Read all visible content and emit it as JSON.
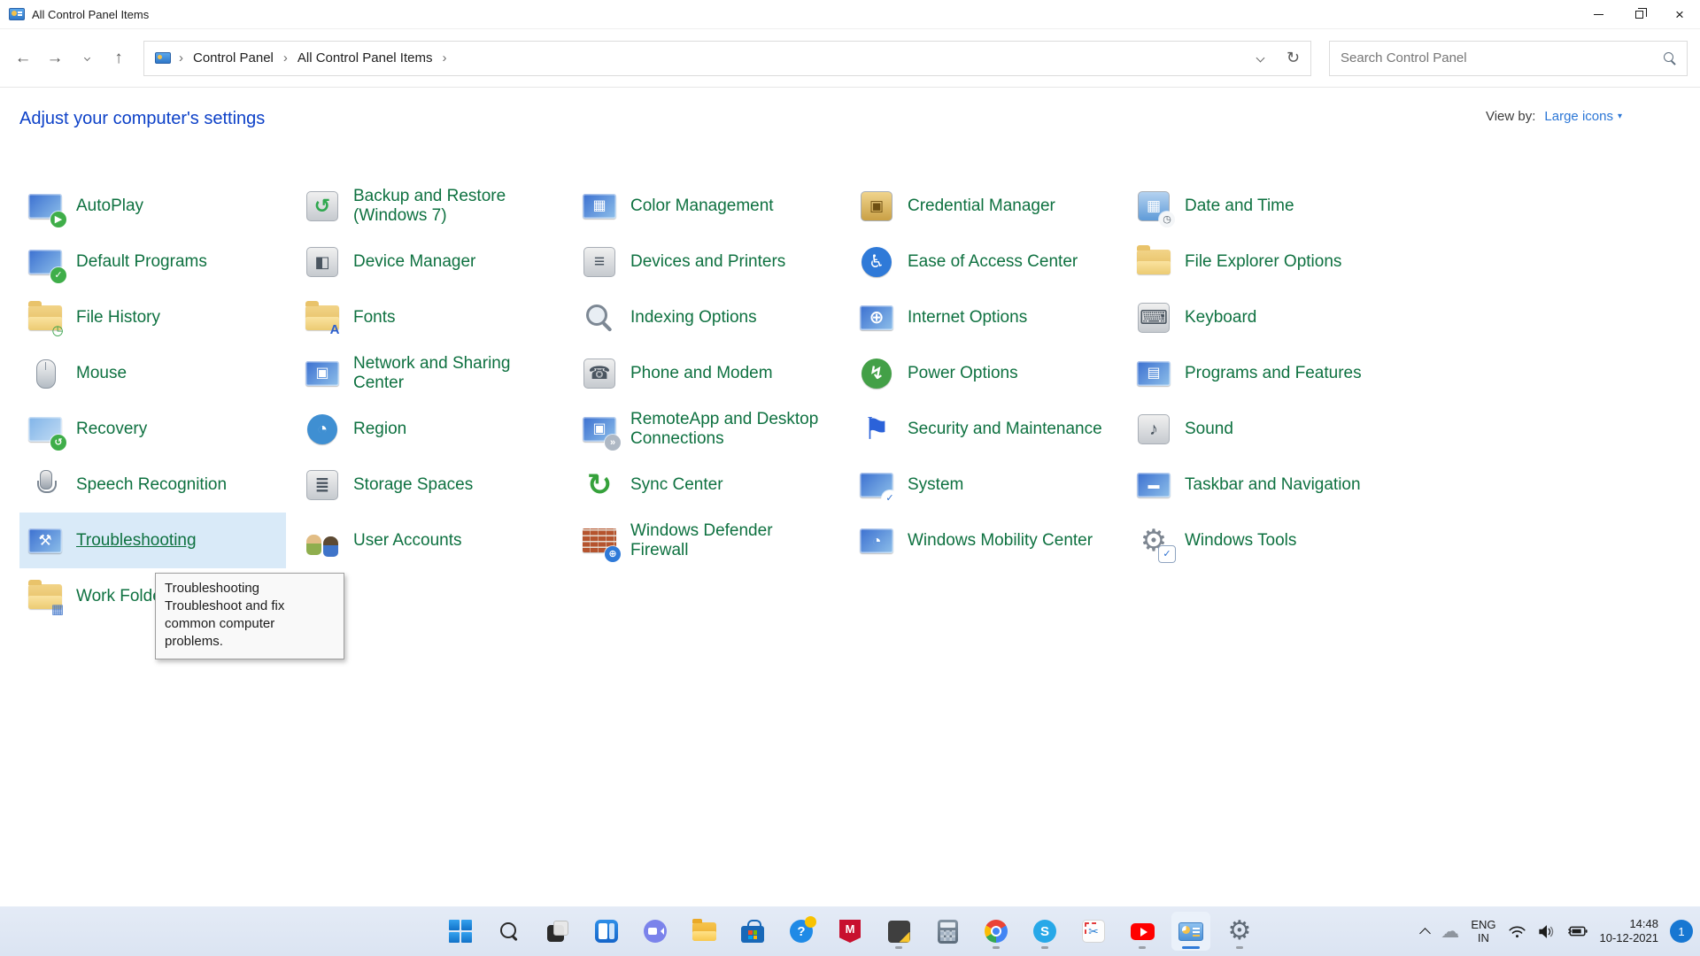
{
  "window": {
    "title": "All Control Panel Items",
    "minimize": "minimize",
    "restore": "restore",
    "close": "×"
  },
  "nav": {
    "back": "←",
    "forward": "→",
    "up": "↑",
    "refresh": "↻",
    "crumb_sep": "›",
    "breadcrumb": [
      "Control Panel",
      "All Control Panel Items"
    ],
    "search_placeholder": "Search Control Panel"
  },
  "header": {
    "title": "Adjust your computer's settings",
    "view_by_label": "View by:",
    "view_by_value": "Large icons",
    "caret": "▾"
  },
  "colors": {
    "heading_link": "#0d41c8",
    "item_link": "#0e7140",
    "viewby_value": "#2b76d6",
    "hover_bg": "#d9eaf8",
    "taskbar_bg": "#dfe8f4"
  },
  "items": [
    {
      "label": "AutoPlay",
      "icon": {
        "kind": "screen",
        "badge": {
          "bg": "#3fae49",
          "glyph": "▶",
          "color": "#ffffff"
        }
      }
    },
    {
      "label": "Backup and Restore (Windows 7)",
      "icon": {
        "kind": "rect",
        "glyph": "↺",
        "gcolor": "#2fa84f",
        "gsize": 22
      }
    },
    {
      "label": "Color Management",
      "icon": {
        "kind": "screen",
        "glyph": "▦",
        "gcolor": "#ffffff",
        "gsize": 16
      }
    },
    {
      "label": "Credential Manager",
      "icon": {
        "kind": "rect",
        "bg": "linear-gradient(#f0d48c,#c9a045)",
        "glyph": "▣",
        "gcolor": "#6e4f12",
        "gsize": 17
      }
    },
    {
      "label": "Date and Time",
      "icon": {
        "kind": "rect",
        "bg": "linear-gradient(#b4d2f0,#5f9bd8)",
        "glyph": "▦",
        "gcolor": "#ffffff",
        "gsize": 17,
        "badge": {
          "bg": "#f4f6f8",
          "glyph": "◷",
          "color": "#5a6570"
        }
      }
    },
    {
      "label": "Default Programs",
      "icon": {
        "kind": "screen",
        "badge": {
          "bg": "#3fae49",
          "glyph": "✓",
          "color": "#ffffff"
        }
      }
    },
    {
      "label": "Device Manager",
      "icon": {
        "kind": "rect",
        "glyph": "◧",
        "gcolor": "#4a5560",
        "gsize": 18
      }
    },
    {
      "label": "Devices and Printers",
      "icon": {
        "kind": "rect",
        "glyph": "≡",
        "gcolor": "#4a5560",
        "gsize": 21
      }
    },
    {
      "label": "Ease of Access Center",
      "icon": {
        "kind": "circle",
        "glyph": "♿",
        "gcolor": "#ffffff",
        "gsize": 20
      }
    },
    {
      "label": "File Explorer Options",
      "icon": {
        "kind": "folder"
      }
    },
    {
      "label": "File History",
      "icon": {
        "kind": "folder",
        "badge": {
          "bg": "none",
          "glyph": "◷",
          "color": "#2f9e44"
        }
      }
    },
    {
      "label": "Fonts",
      "icon": {
        "kind": "folder",
        "badge": {
          "bg": "none",
          "glyph": "A",
          "color": "#2b5fd0"
        }
      }
    },
    {
      "label": "Indexing Options",
      "icon": {
        "kind": "magnifier"
      }
    },
    {
      "label": "Internet Options",
      "icon": {
        "kind": "screen",
        "glyph": "⊕",
        "gcolor": "#ffffff",
        "gsize": 20
      }
    },
    {
      "label": "Keyboard",
      "icon": {
        "kind": "rect",
        "glyph": "⌨",
        "gcolor": "#4a5560",
        "gsize": 22
      }
    },
    {
      "label": "Mouse",
      "icon": {
        "kind": "mouse"
      }
    },
    {
      "label": "Network and Sharing Center",
      "icon": {
        "kind": "screen",
        "glyph": "▣",
        "gcolor": "#ffffff",
        "gsize": 16
      }
    },
    {
      "label": "Phone and Modem",
      "icon": {
        "kind": "rect",
        "glyph": "☎",
        "gcolor": "#4a5560",
        "gsize": 20
      }
    },
    {
      "label": "Power Options",
      "icon": {
        "kind": "circle",
        "bg": "#43a047",
        "glyph": "↯",
        "gcolor": "#ffffff",
        "gsize": 20
      }
    },
    {
      "label": "Programs and Features",
      "icon": {
        "kind": "screen",
        "glyph": "▤",
        "gcolor": "#ffffff",
        "gsize": 16
      }
    },
    {
      "label": "Recovery",
      "icon": {
        "kind": "screen",
        "bg": "linear-gradient(135deg,#7fb3e8,#c4ddf4)",
        "badge": {
          "bg": "#3fae49",
          "glyph": "↺",
          "color": "#ffffff"
        }
      }
    },
    {
      "label": "Region",
      "icon": {
        "kind": "circle",
        "bg": "#3f8fd2",
        "glyph": "◔",
        "gcolor": "#ffffff",
        "gsize": 20
      }
    },
    {
      "label": "RemoteApp and Desktop Connections",
      "icon": {
        "kind": "screen",
        "glyph": "▣",
        "gcolor": "#ffffff",
        "gsize": 16,
        "badge": {
          "bg": "#aeb8c4",
          "glyph": "»",
          "color": "#ffffff"
        }
      }
    },
    {
      "label": "Security and Maintenance",
      "icon": {
        "kind": "flag",
        "glyph": "⚑",
        "gcolor": "#2b62d9",
        "gsize": 34
      }
    },
    {
      "label": "Sound",
      "icon": {
        "kind": "rect",
        "glyph": "♪",
        "gcolor": "#4a5560",
        "gsize": 20
      }
    },
    {
      "label": "Speech Recognition",
      "icon": {
        "kind": "mic"
      }
    },
    {
      "label": "Storage Spaces",
      "icon": {
        "kind": "rect",
        "glyph": "≣",
        "gcolor": "#4a5560",
        "gsize": 20
      }
    },
    {
      "label": "Sync Center",
      "icon": {
        "kind": "glyph",
        "glyph": "↻",
        "gcolor": "#35a13b",
        "gsize": 34
      }
    },
    {
      "label": "System",
      "icon": {
        "kind": "screen",
        "badge": {
          "bg": "#ffffff",
          "glyph": "✓",
          "color": "#2b6fd0"
        }
      }
    },
    {
      "label": "Taskbar and Navigation",
      "icon": {
        "kind": "screen",
        "glyph": "▬",
        "gcolor": "#ffffff",
        "gsize": 13
      }
    },
    {
      "label": "Troubleshooting",
      "hovered": true,
      "icon": {
        "kind": "screen",
        "glyph": "⚒",
        "gcolor": "#ffffff",
        "gsize": 17
      }
    },
    {
      "label": "User Accounts",
      "icon": {
        "kind": "people"
      }
    },
    {
      "label": "Windows Defender Firewall",
      "icon": {
        "kind": "wall",
        "badge": {
          "bg": "#2f7ad8",
          "glyph": "⊕",
          "color": "#ffffff"
        }
      }
    },
    {
      "label": "Windows Mobility Center",
      "icon": {
        "kind": "screen",
        "glyph": "◔",
        "gcolor": "#ffffff",
        "gsize": 18
      }
    },
    {
      "label": "Windows Tools",
      "icon": {
        "kind": "glyph",
        "glyph": "⚙",
        "gcolor": "#7d8691",
        "gsize": 34,
        "badge": {
          "bg": "#ffffff",
          "glyph": "✓",
          "color": "#2b6fd0",
          "square": true
        }
      }
    },
    {
      "label": "Work Folders",
      "icon": {
        "kind": "folder",
        "badge": {
          "bg": "none",
          "glyph": "▦",
          "color": "#3f74c9"
        }
      }
    }
  ],
  "tooltip": {
    "title": "Troubleshooting",
    "body": "Troubleshoot and fix common computer problems."
  },
  "taskbar": {
    "buttons": [
      {
        "name": "start",
        "kind": "win",
        "indicator": "none"
      },
      {
        "name": "search",
        "kind": "search",
        "indicator": "none"
      },
      {
        "name": "task-view",
        "kind": "taskview",
        "indicator": "none"
      },
      {
        "name": "widgets",
        "kind": "widgets",
        "indicator": "none"
      },
      {
        "name": "chat",
        "kind": "chat",
        "indicator": "none"
      },
      {
        "name": "file-explorer",
        "kind": "folder",
        "indicator": "none"
      },
      {
        "name": "microsoft-store",
        "kind": "store",
        "indicator": "none"
      },
      {
        "name": "get-help",
        "kind": "gethelp",
        "glyph": "?",
        "indicator": "none"
      },
      {
        "name": "mcafee",
        "kind": "mcafee",
        "glyph": "M",
        "indicator": "none"
      },
      {
        "name": "sticky-notes",
        "kind": "sticky",
        "indicator": "dot"
      },
      {
        "name": "calculator",
        "kind": "calc",
        "indicator": "none"
      },
      {
        "name": "chrome",
        "kind": "chrome",
        "indicator": "dot"
      },
      {
        "name": "skype",
        "kind": "skype",
        "glyph": "S",
        "indicator": "dot"
      },
      {
        "name": "snipping-tool",
        "kind": "snip",
        "glyph": "✂",
        "indicator": "none"
      },
      {
        "name": "youtube",
        "kind": "youtube",
        "indicator": "dot"
      },
      {
        "name": "control-panel",
        "kind": "cpanel",
        "indicator": "active",
        "active": true
      },
      {
        "name": "settings",
        "kind": "gear",
        "glyph": "⚙",
        "indicator": "dot"
      }
    ],
    "tray": {
      "cloud": "☁",
      "lang_line1": "ENG",
      "lang_line2": "IN",
      "time": "14:48",
      "date": "10-12-2021",
      "badge": "1"
    }
  }
}
